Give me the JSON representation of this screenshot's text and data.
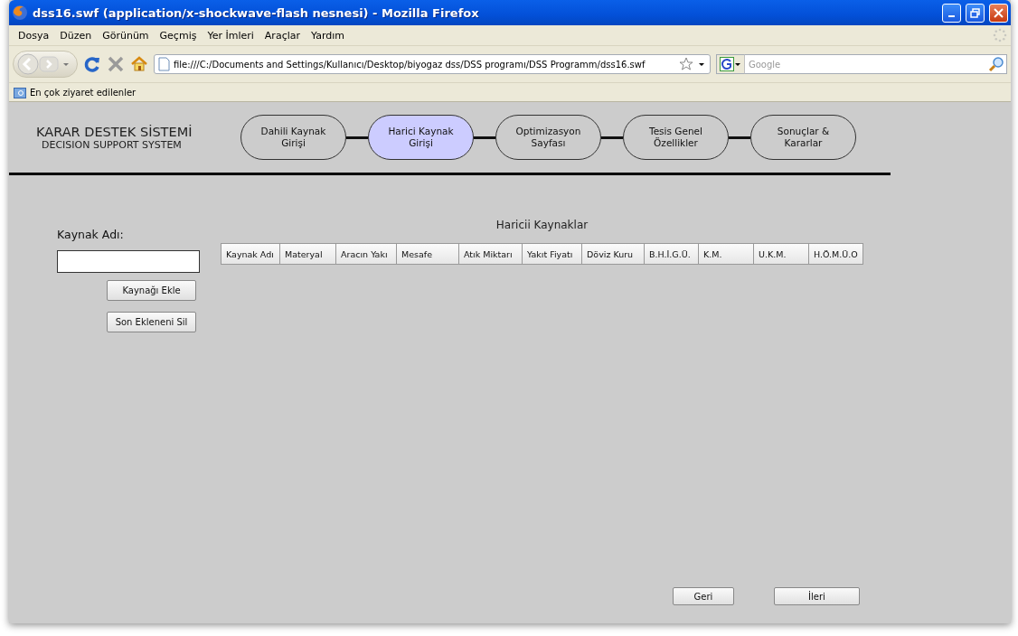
{
  "window": {
    "title": "dss16.swf (application/x-shockwave-flash nesnesi) - Mozilla Firefox"
  },
  "menu": [
    "Dosya",
    "Düzen",
    "Görünüm",
    "Geçmiş",
    "Yer İmleri",
    "Araçlar",
    "Yardım"
  ],
  "address_bar": {
    "value": "file:///C:/Documents and Settings/Kullanıcı/Desktop/biyogaz dss/DSS programı/DSS Programm/dss16.swf"
  },
  "search": {
    "placeholder": "Google"
  },
  "bookmarks": [
    "En çok ziyaret edilenler"
  ],
  "app": {
    "title": "KARAR DESTEK SİSTEMİ",
    "subtitle": "DECISION SUPPORT SYSTEM",
    "steps": [
      {
        "label": "Dahili Kaynak\nGirişi",
        "selected": false
      },
      {
        "label": "Harici Kaynak\nGirişi",
        "selected": true
      },
      {
        "label": "Optimizasyon\nSayfası",
        "selected": false
      },
      {
        "label": "Tesis Genel\nÖzellikler",
        "selected": false
      },
      {
        "label": "Sonuçlar &\nKararlar",
        "selected": false
      }
    ],
    "field_label": "Kaynak Adı:",
    "buttons": [
      "Kaynağı Ekle",
      "Son Ekleneni Sil"
    ],
    "table": {
      "title": "Haricii Kaynaklar",
      "columns": [
        "Kaynak Adı",
        "Materyal",
        "Aracın Yakı",
        "Mesafe",
        "Atık Miktarı",
        "Yakıt Fiyatı",
        "Döviz Kuru",
        "B.H.İ.G.Ü.",
        "K.M.",
        "U.K.M.",
        "H.Ö.M.Ü.O"
      ]
    },
    "nav_buttons": [
      "Geri",
      "İleri"
    ]
  }
}
